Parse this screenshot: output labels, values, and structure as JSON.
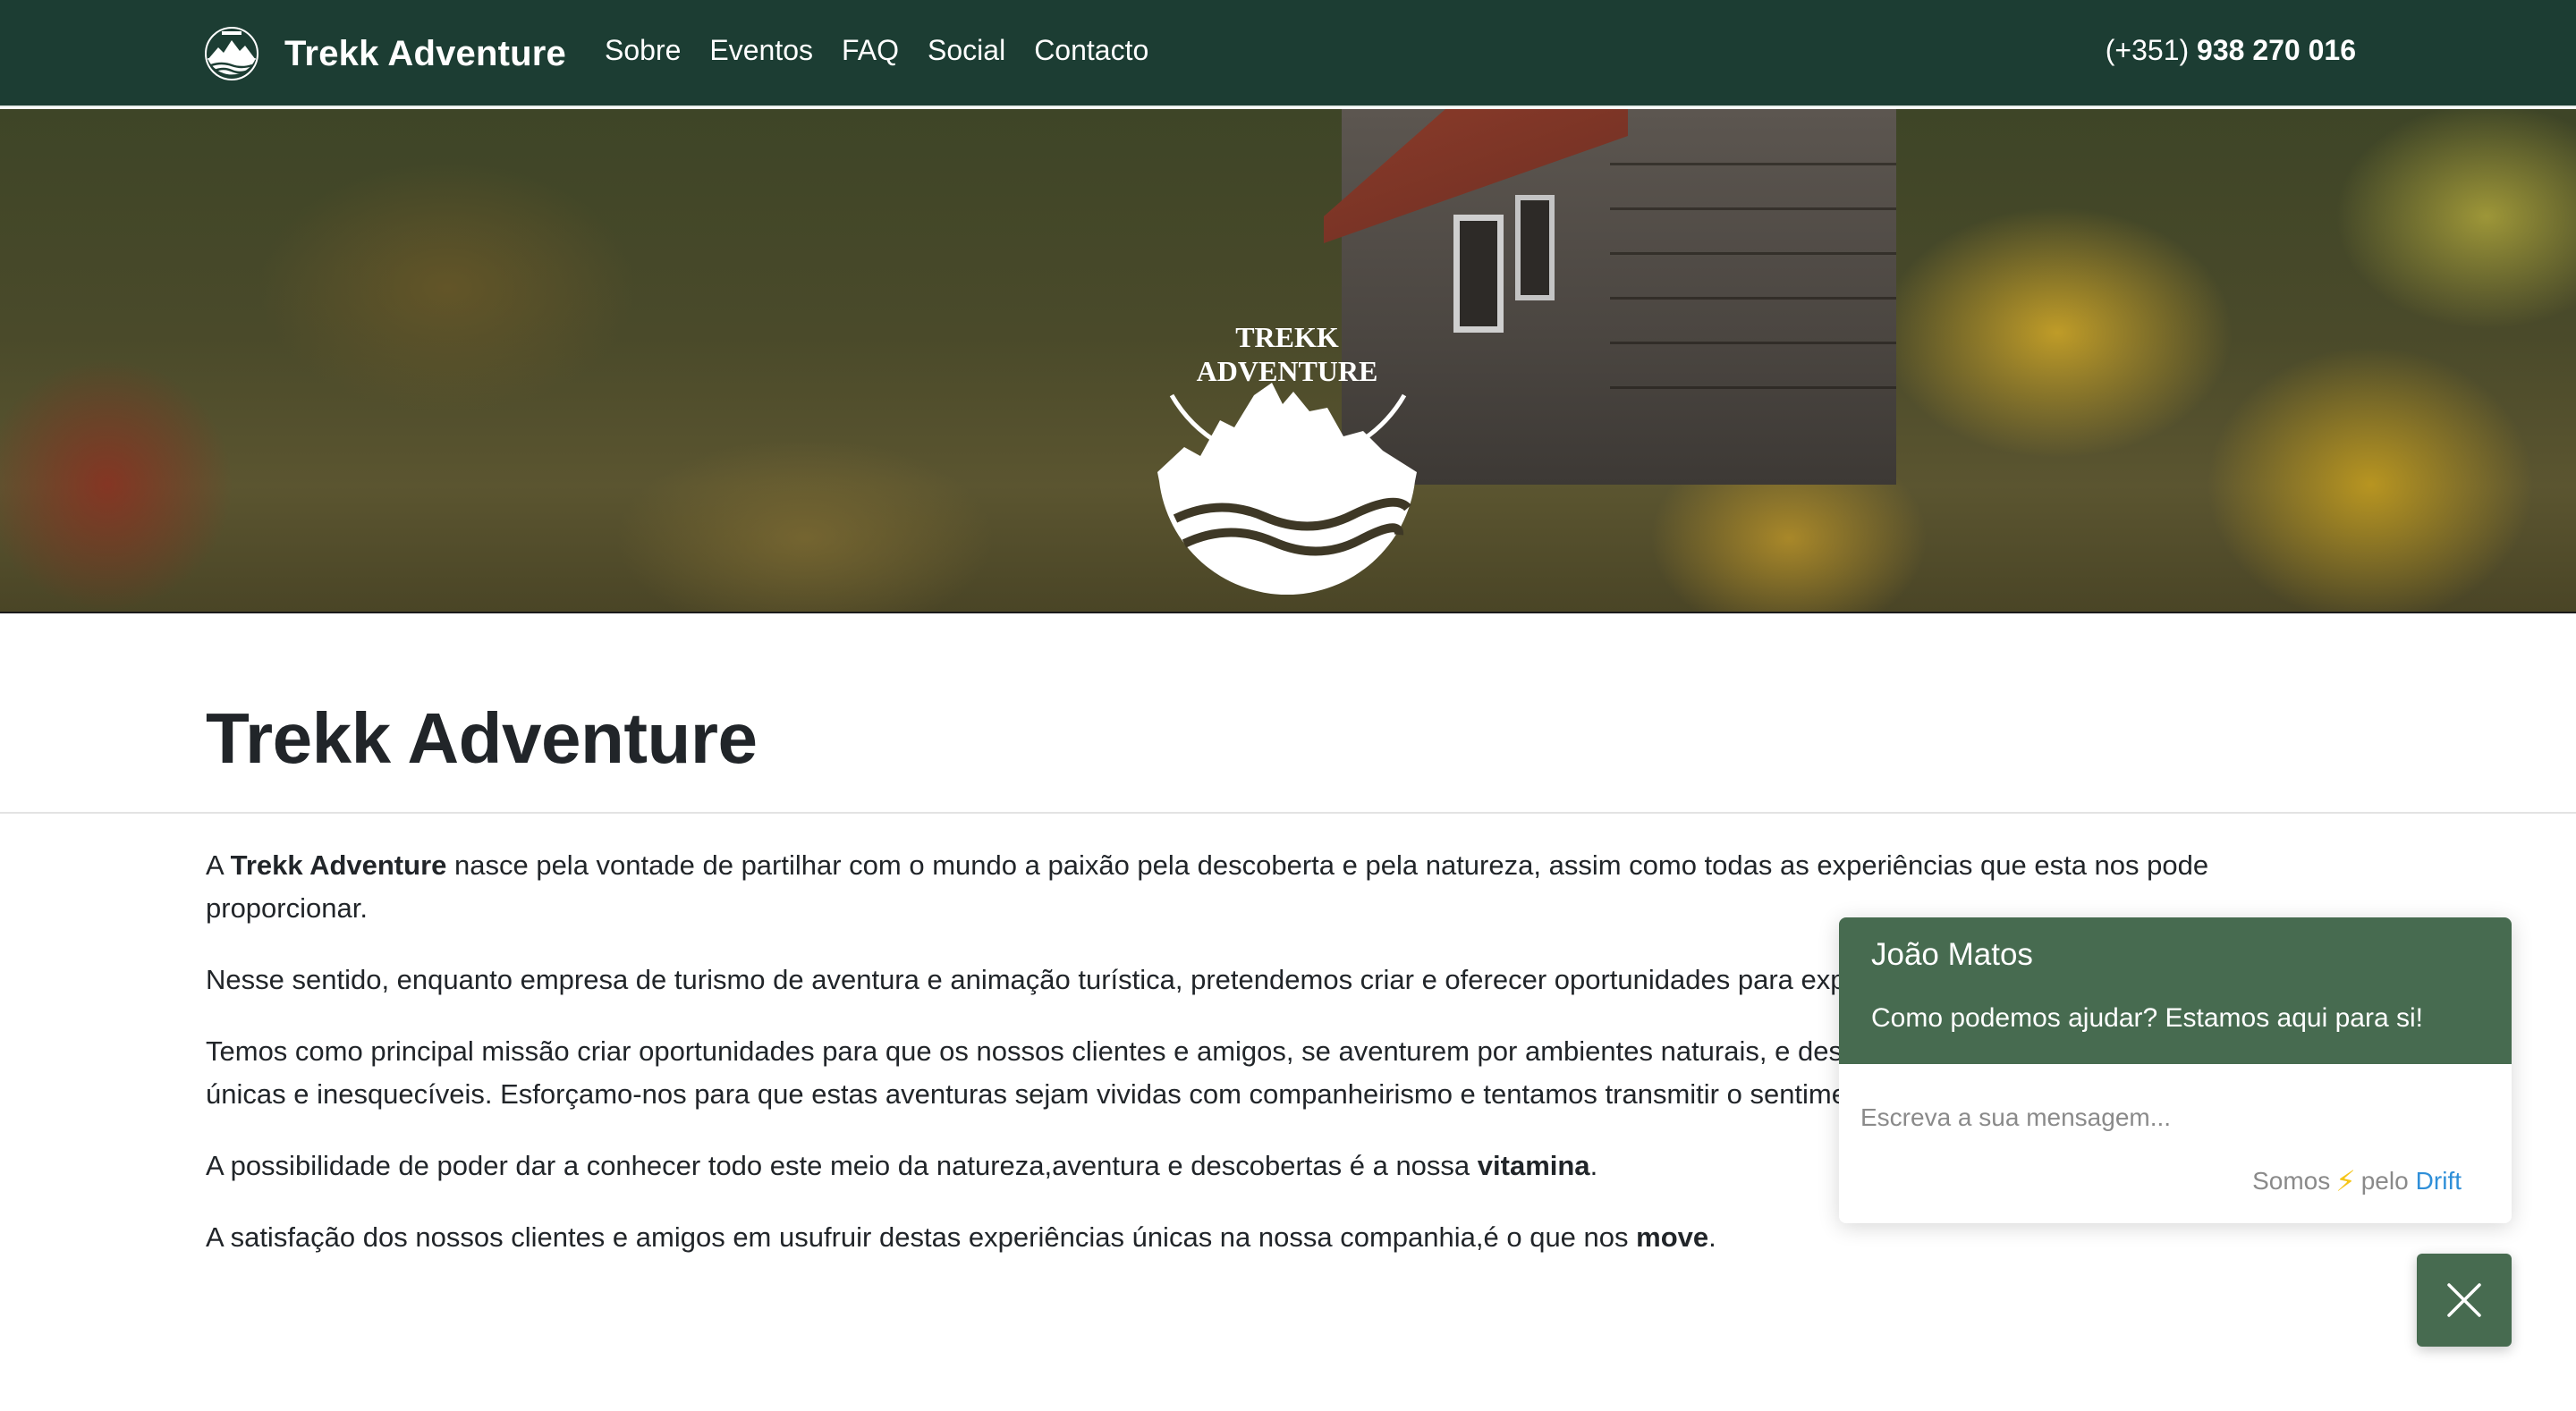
{
  "nav": {
    "brand": "Trekk Adventure",
    "logo_icon": "mountain-logo-icon",
    "links": [
      "Sobre",
      "Eventos",
      "FAQ",
      "Social",
      "Contacto"
    ],
    "phone_prefix": "(+351)",
    "phone_number": "938 270 016"
  },
  "hero": {
    "logo_line1": "TREKK",
    "logo_line2": "ADVENTURE",
    "logo_icon": "mountain-waves-icon"
  },
  "main": {
    "title": "Trekk Adventure",
    "p1": {
      "pre": "A ",
      "bold": "Trekk Adventure",
      "post": " nasce pela vontade de partilhar com o mundo a paixão pela descoberta e pela natureza, assim como todas as experiências que esta nos pode proporcionar."
    },
    "p2": "Nesse sentido, enquanto empresa de turismo de aventura e animação turística, pretendemos criar e oferecer oportunidades para experiências únicas e inesquecíveis.",
    "p3": "Temos como principal missão criar oportunidades para que os nossos clientes e amigos, se aventurem por ambientes naturais, e desta forma poderem usufruir de experiências únicas e inesquecíveis. Esforçamo-nos para que estas aventuras sejam vividas com companheirismo e tentamos transmitir o sentimento de bem-estar com a natureza.",
    "p4": {
      "pre": "A possibilidade de poder dar a conhecer todo este meio da natureza,aventura e descobertas é a nossa ",
      "bold": "vitamina",
      "post": "."
    },
    "p5": {
      "pre": "A satisfação dos nossos clientes e amigos em usufruir destas experiências únicas na nossa companhia,é o que nos ",
      "bold": "move",
      "post": "."
    }
  },
  "chat": {
    "agent_name": "João Matos",
    "message": "Como podemos ajudar? Estamos aqui para si!",
    "input_placeholder": "Escreva a sua mensagem...",
    "footer_pre": "Somos",
    "footer_icon": "lightning-bolt-icon",
    "footer_mid": "pelo",
    "footer_link": "Drift",
    "close_icon": "close-icon"
  },
  "colors": {
    "navbar": "#1c3d33",
    "chat_accent": "#476b50",
    "link_blue": "#2f8fd8",
    "bolt_yellow": "#f5c518"
  }
}
